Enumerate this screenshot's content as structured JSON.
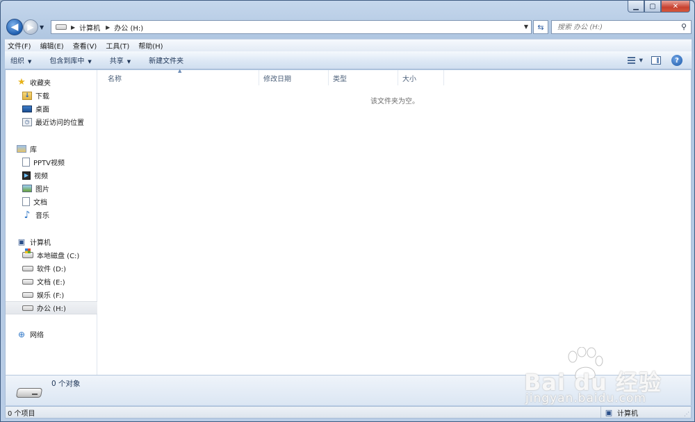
{
  "window": {
    "minimize_icon": "minimize-icon",
    "maximize_icon": "maximize-icon",
    "close_icon": "close-icon"
  },
  "address_bar": {
    "crumbs": [
      "计算机",
      "办公 (H:)"
    ]
  },
  "search": {
    "placeholder": "搜索 办公 (H:)"
  },
  "menu": [
    "文件(F)",
    "编辑(E)",
    "查看(V)",
    "工具(T)",
    "帮助(H)"
  ],
  "toolbar": {
    "organize": "组织",
    "include_in_library": "包含到库中",
    "share": "共享",
    "new_folder": "新建文件夹"
  },
  "nav_pane": {
    "favorites": {
      "label": "收藏夹",
      "items": [
        "下载",
        "桌面",
        "最近访问的位置"
      ]
    },
    "libraries": {
      "label": "库",
      "items": [
        "PPTV视频",
        "视频",
        "图片",
        "文档",
        "音乐"
      ]
    },
    "computer": {
      "label": "计算机",
      "items": [
        "本地磁盘 (C:)",
        "软件 (D:)",
        "文档 (E:)",
        "娱乐 (F:)",
        "办公 (H:)"
      ],
      "selected": "办公 (H:)"
    },
    "network": {
      "label": "网络"
    }
  },
  "columns": [
    "名称",
    "修改日期",
    "类型",
    "大小"
  ],
  "empty_message": "该文件夹为空。",
  "details_pane": {
    "count": "0 个对象"
  },
  "status_bar": {
    "items": "0 个项目",
    "location": "计算机"
  },
  "watermark": {
    "brand": "Bai du 经验",
    "url": "jingyan.baidu.com"
  }
}
